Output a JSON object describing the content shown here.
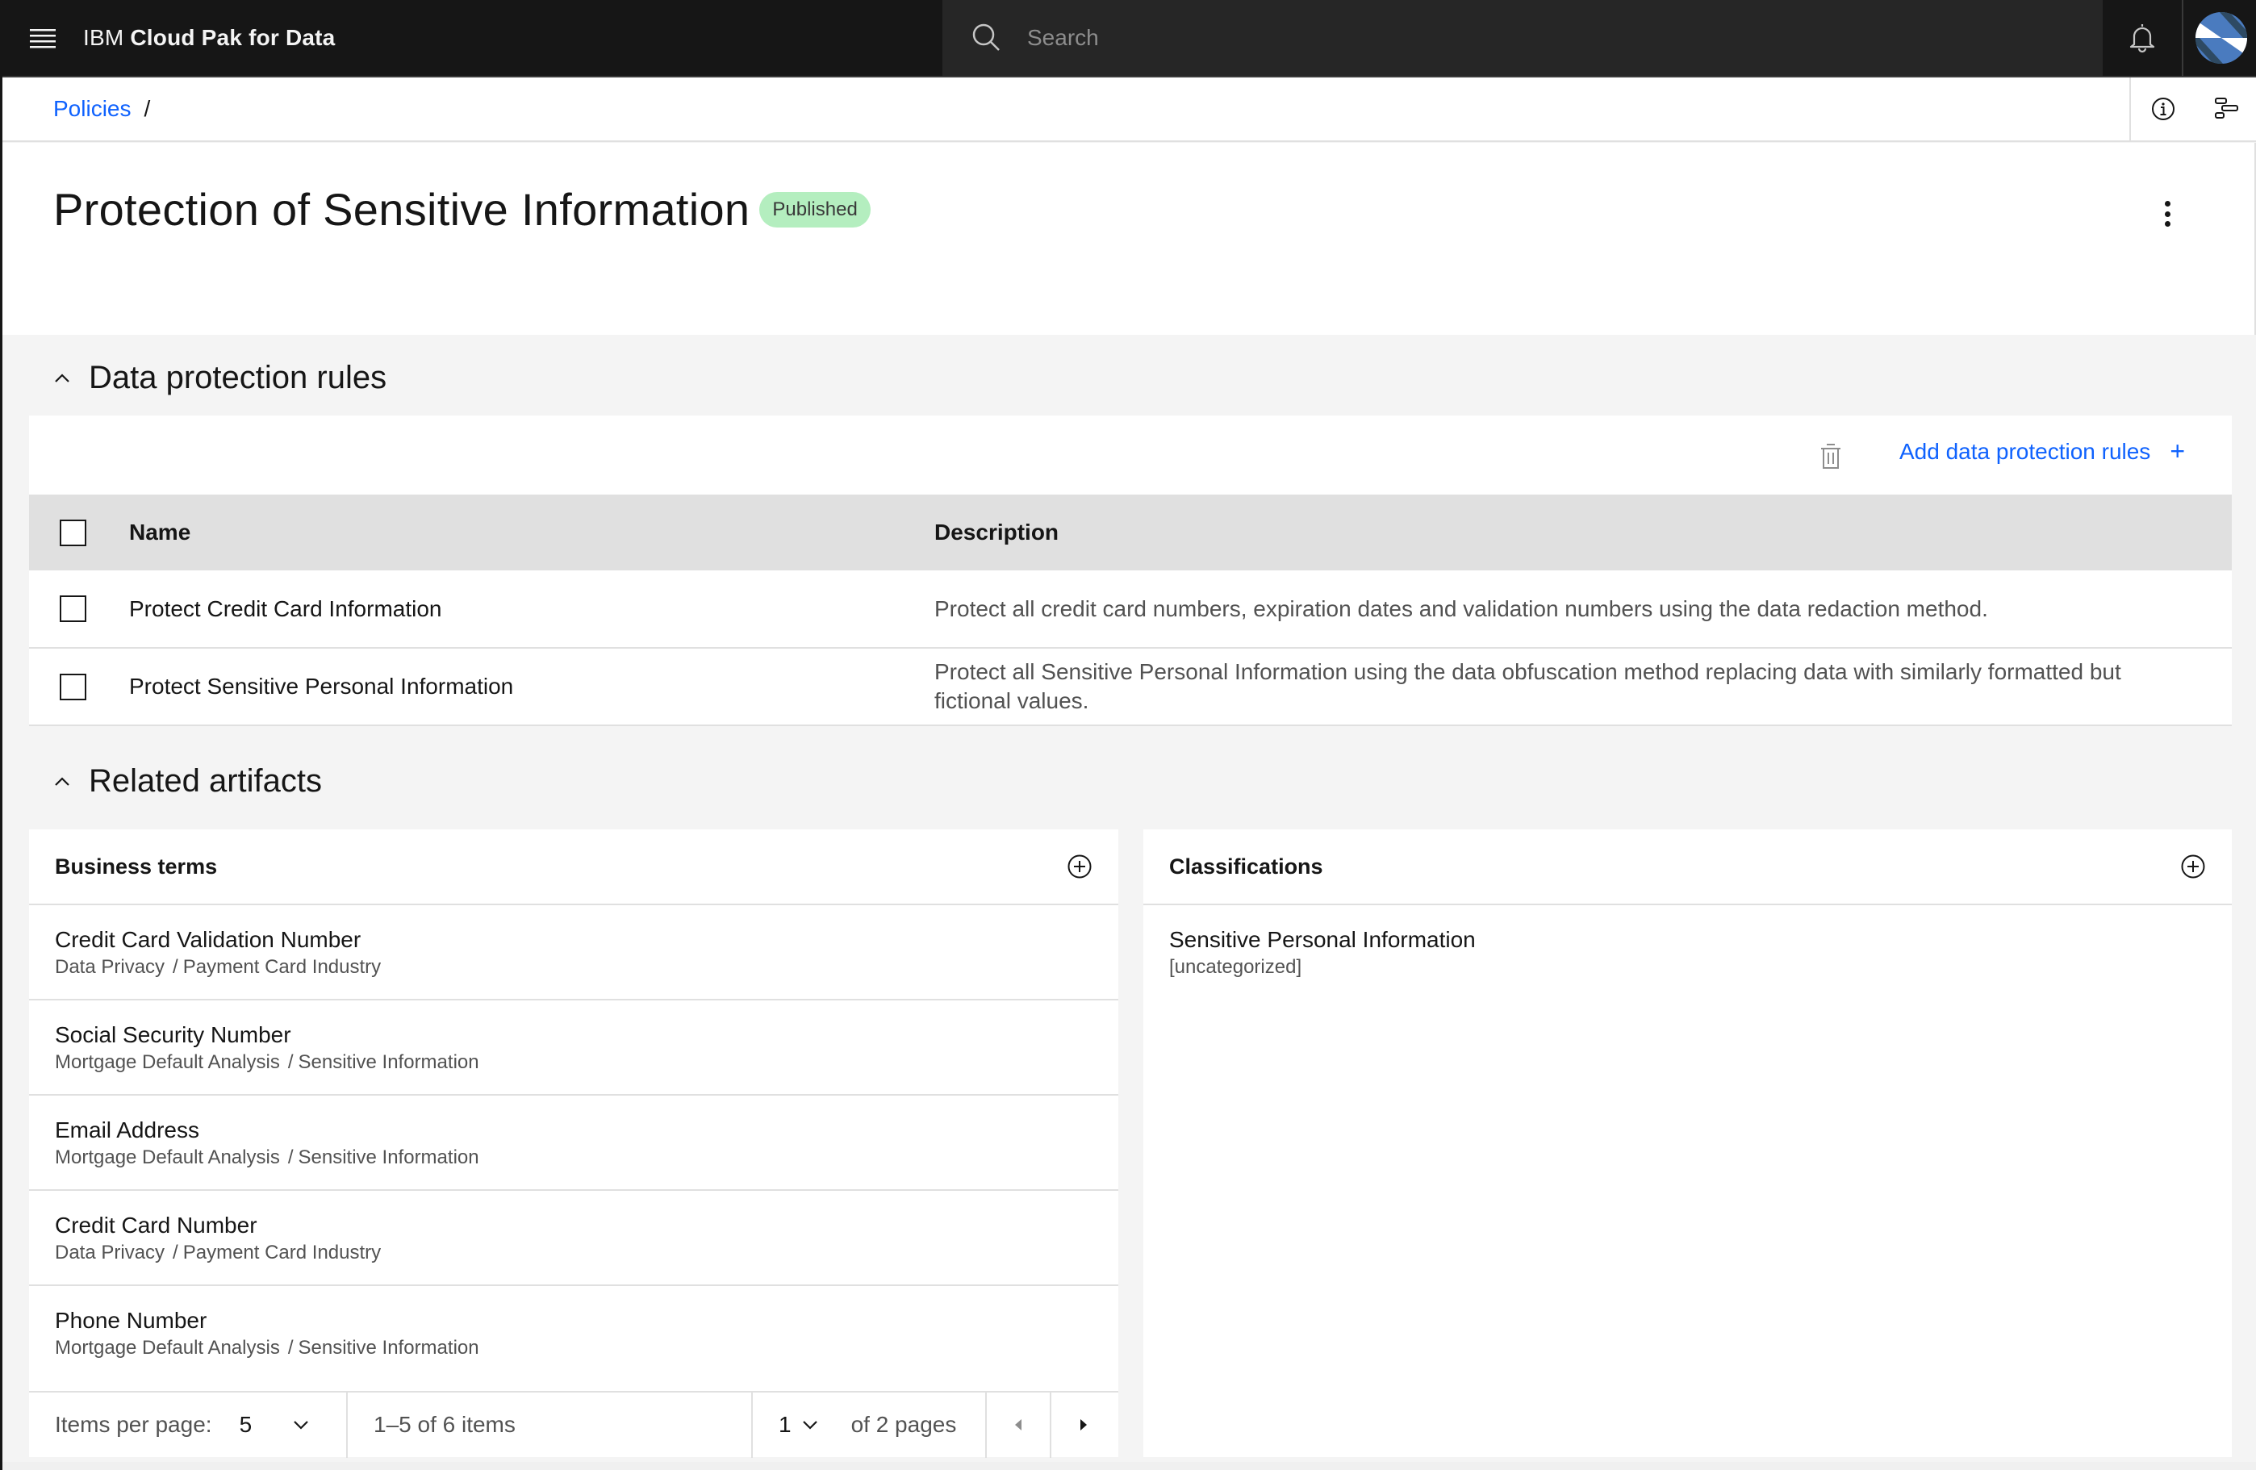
{
  "app": {
    "brand_prefix": "IBM",
    "brand_name": "Cloud Pak for Data",
    "search_placeholder": "Search",
    "icons": {
      "menu": "hamburger-menu-icon",
      "search": "search-icon",
      "notifications": "bell-icon",
      "avatar": "user-avatar"
    }
  },
  "breadcrumb": {
    "items": [
      {
        "label": "Policies"
      }
    ],
    "separator": "/",
    "actions": [
      "info-icon",
      "lineage-icon"
    ]
  },
  "page": {
    "title": "Protection of Sensitive Information",
    "status": "Published",
    "status_color": "#b4eebf",
    "overflow_menu": "overflow-menu-icon"
  },
  "rules_section": {
    "heading": "Data protection rules",
    "add_label": "Add data protection rules",
    "add_icon": "+",
    "columns": [
      "Name",
      "Description"
    ],
    "rows": [
      {
        "name": "Protect Credit Card Information",
        "description": "Protect all credit card numbers, expiration dates and validation numbers using the data redaction method."
      },
      {
        "name": "Protect Sensitive Personal Information",
        "description": "Protect all Sensitive Personal Information using the data obfuscation method replacing data with similarly formatted but fictional values."
      }
    ]
  },
  "artifacts_section": {
    "heading": "Related artifacts",
    "business_terms": {
      "title": "Business terms",
      "items": [
        {
          "name": "Credit Card Validation Number",
          "path": [
            "Data Privacy",
            "Payment Card Industry"
          ]
        },
        {
          "name": "Social Security Number",
          "path": [
            "Mortgage Default Analysis",
            "Sensitive Information"
          ]
        },
        {
          "name": "Email Address",
          "path": [
            "Mortgage Default Analysis",
            "Sensitive Information"
          ]
        },
        {
          "name": "Credit Card Number",
          "path": [
            "Data Privacy",
            "Payment Card Industry"
          ]
        },
        {
          "name": "Phone Number",
          "path": [
            "Mortgage Default Analysis",
            "Sensitive Information"
          ]
        }
      ],
      "pagination": {
        "items_per_page_label": "Items per page:",
        "items_per_page": "5",
        "range_text": "1–5 of 6 items",
        "current_page": "1",
        "pages_text": "of 2 pages"
      }
    },
    "classifications": {
      "title": "Classifications",
      "items": [
        {
          "name": "Sensitive Personal Information",
          "category": "[uncategorized]"
        }
      ]
    }
  },
  "colors": {
    "accent": "#0f62fe",
    "topnav": "#161616",
    "search_bg": "#262626",
    "page_bg": "#f4f4f4",
    "table_header": "#e0e0e0"
  }
}
